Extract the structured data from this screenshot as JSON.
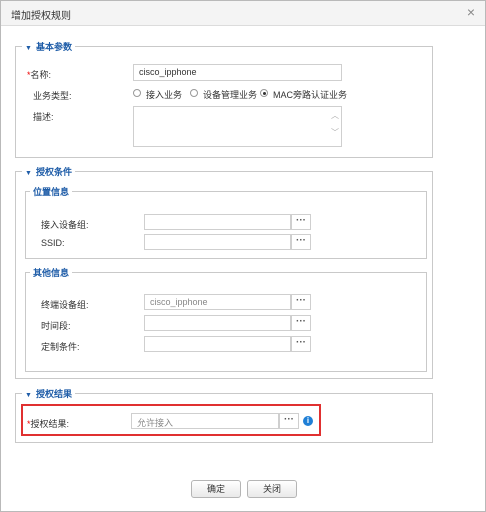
{
  "dialog": {
    "title": "增加授权规则",
    "close_glyph": "×"
  },
  "basic": {
    "legend": "基本参数",
    "name_label": "名称:",
    "name_value": "cisco_ipphone",
    "type_label": "业务类型:",
    "options": [
      "接入业务",
      "设备管理业务",
      "MAC旁路认证业务"
    ],
    "selected_option": "MAC旁路认证业务",
    "desc_label": "描述:"
  },
  "conditions": {
    "legend": "授权条件",
    "location": {
      "legend": "位置信息",
      "device_group_label": "接入设备组:",
      "ssid_label": "SSID:"
    },
    "other": {
      "legend": "其他信息",
      "terminal_group_label": "终端设备组:",
      "terminal_group_value": "cisco_ipphone",
      "time_label": "时间段:",
      "custom_label": "定制条件:"
    }
  },
  "result": {
    "legend": "授权结果",
    "result_label": "授权结果:",
    "result_value": "允许接入"
  },
  "buttons": {
    "ok": "确定",
    "close": "关闭"
  },
  "glyphs": {
    "dots": "···",
    "legend_triangle": "▼",
    "required": "*",
    "info": "i",
    "spin_up": "︿",
    "spin_down": "﹀"
  },
  "colors": {
    "legend": "#1f5da8",
    "highlight": "#e03030",
    "info": "#1f7fd6"
  }
}
